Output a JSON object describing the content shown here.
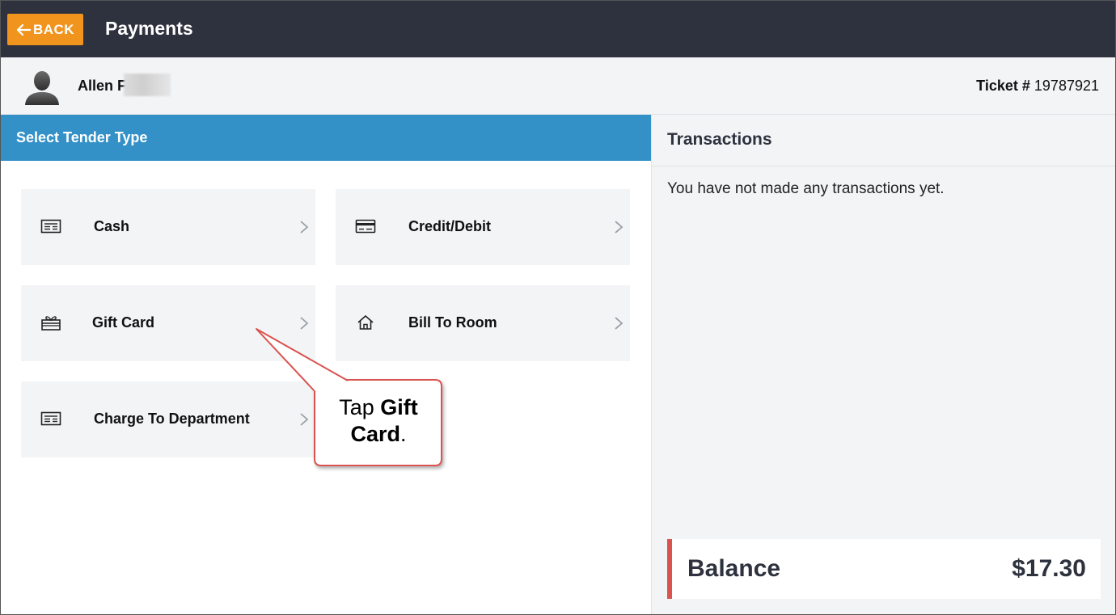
{
  "header": {
    "back_label": "BACK",
    "title": "Payments"
  },
  "customer": {
    "name": "Allen F",
    "ticket_label": "Ticket #",
    "ticket_number": "19787921"
  },
  "tender": {
    "header": "Select Tender Type",
    "options": [
      {
        "label": "Cash",
        "icon": "cash-icon"
      },
      {
        "label": "Credit/Debit",
        "icon": "credit-card-icon"
      },
      {
        "label": "Gift Card",
        "icon": "gift-icon"
      },
      {
        "label": "Bill To Room",
        "icon": "home-icon"
      },
      {
        "label": "Charge To Department",
        "icon": "cash-icon"
      }
    ]
  },
  "transactions": {
    "title": "Transactions",
    "empty_message": "You have not made any transactions yet.",
    "balance_label": "Balance",
    "balance_value": "$17.30"
  },
  "callout": {
    "prefix": "Tap ",
    "bold": "Gift Card",
    "suffix": "."
  },
  "colors": {
    "topbar": "#2d323e",
    "back_button": "#f0941d",
    "section_header": "#3391c8",
    "balance_accent": "#d9534f",
    "callout_border": "#d9534f"
  }
}
